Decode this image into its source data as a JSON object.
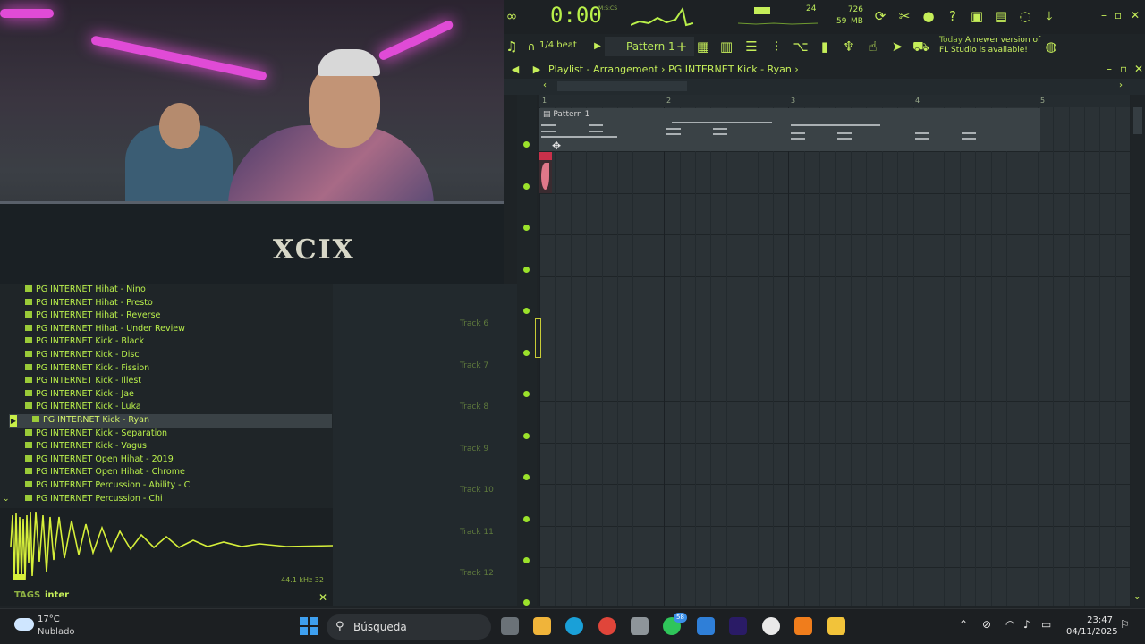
{
  "toolbar": {
    "time": "0:00",
    "time_unit": "M:S:CS",
    "cpu": "24",
    "memory": "726 MB",
    "polyphony": "59",
    "snap": "1/4 beat",
    "pattern": "Pattern 1",
    "news_line1_prefix": "Today",
    "news_line1": "A newer version of",
    "news_line2": "FL Studio is available!"
  },
  "playlist": {
    "title": "Playlist - Arrangement",
    "separator": "›",
    "pattern_name": "PG INTERNET Kick - Ryan",
    "ruler": [
      "1",
      "2",
      "3",
      "4",
      "5"
    ],
    "clip_label": "Pattern 1",
    "tracks": [
      "Track 6",
      "Track 7",
      "Track 8",
      "Track 9",
      "Track 10",
      "Track 11",
      "Track 12"
    ]
  },
  "browser": {
    "items": [
      "PG INTERNET Hihat - Nino",
      "PG INTERNET Hihat - Presto",
      "PG INTERNET Hihat - Reverse",
      "PG INTERNET Hihat - Under Review",
      "PG INTERNET Kick - Black",
      "PG INTERNET Kick - Disc",
      "PG INTERNET Kick - Fission",
      "PG INTERNET Kick - Illest",
      "PG INTERNET Kick - Jae",
      "PG INTERNET Kick - Luka",
      "PG INTERNET Kick - Ryan",
      "PG INTERNET Kick - Separation",
      "PG INTERNET Kick - Vagus",
      "PG INTERNET Open Hihat - 2019",
      "PG INTERNET Open Hihat - Chrome",
      "PG INTERNET Percussion - Ability - C",
      "PG INTERNET Percussion - Chi"
    ],
    "selected_index": 10,
    "wave_meta": "44.1 kHz 32",
    "tags_label": "TAGS",
    "tags_value": "inter"
  },
  "webcam": {
    "decal": "XCIX"
  },
  "taskbar": {
    "temp": "17°C",
    "condition": "Nublado",
    "search_placeholder": "Búsqueda",
    "whatsapp_badge": "58",
    "time": "23:47",
    "date": "04/11/2025"
  }
}
